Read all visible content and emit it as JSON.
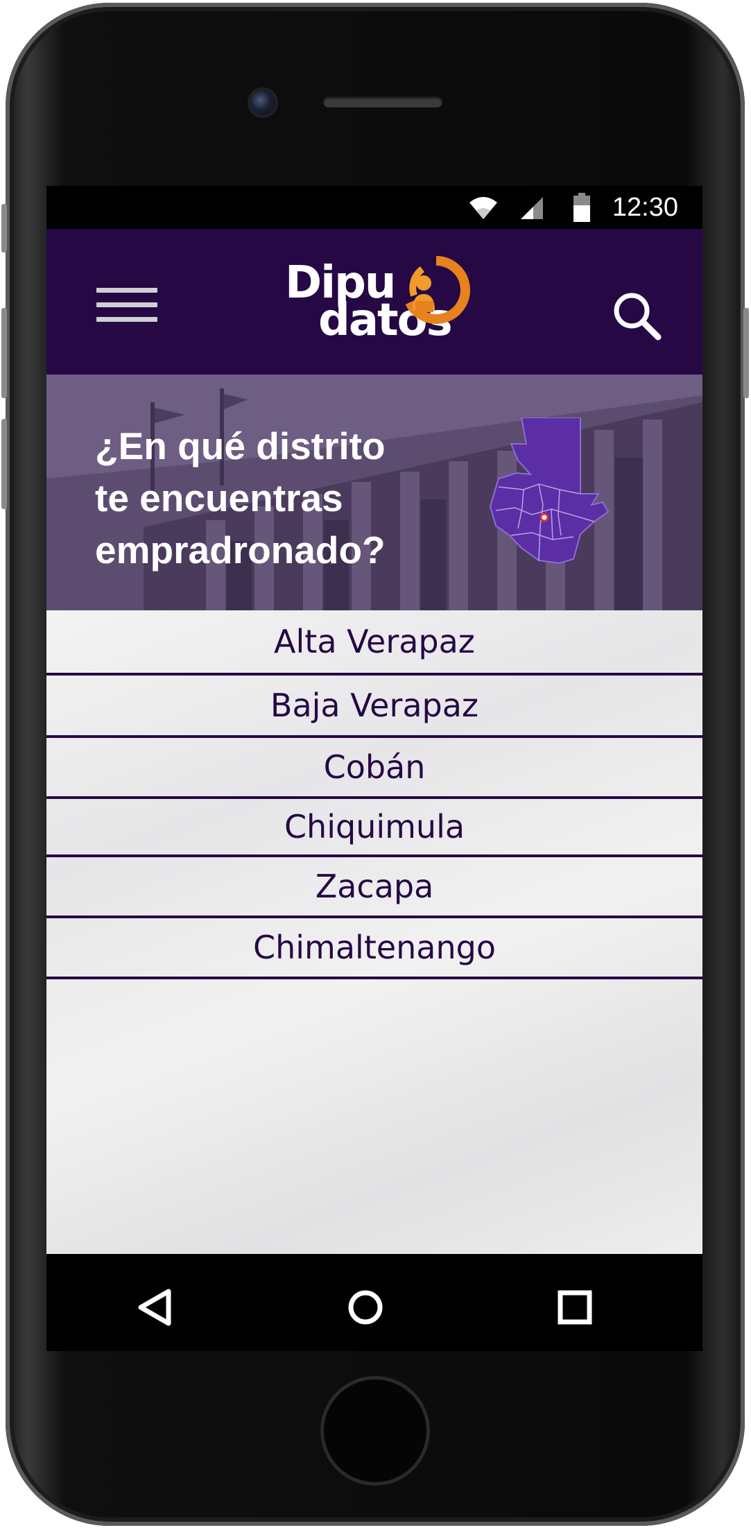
{
  "status_bar": {
    "time": "12:30",
    "icons": [
      "wifi-icon",
      "signal-icon",
      "battery-icon"
    ]
  },
  "app_bar": {
    "menu_icon": "hamburger-menu-icon",
    "logo_line1": "Dipu",
    "logo_line2": "datos",
    "search_icon": "search-icon"
  },
  "hero": {
    "line1": "¿En qué distrito",
    "line2": "te encuentras",
    "line3": "empradronado?",
    "map_icon": "guatemala-map-icon"
  },
  "districts": [
    {
      "label": "Alta Verapaz"
    },
    {
      "label": "Baja Verapaz"
    },
    {
      "label": "Cobán"
    },
    {
      "label": "Chiquimula"
    },
    {
      "label": "Zacapa"
    },
    {
      "label": "Chimaltenango"
    }
  ],
  "nav_bar": {
    "back_icon": "back-triangle-icon",
    "home_icon": "home-circle-icon",
    "recents_icon": "recents-square-icon"
  },
  "colors": {
    "primary": "#260845",
    "accent": "#e8821e",
    "map_fill": "#5b2ea6"
  }
}
